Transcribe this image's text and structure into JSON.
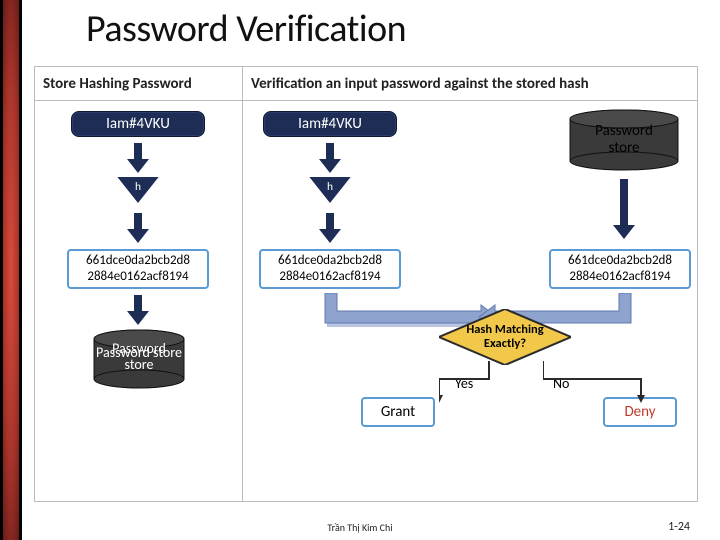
{
  "slide": {
    "title": "Password Verification",
    "columns": {
      "store_heading": "Store Hashing Password",
      "verify_heading": "Verification an input password against the stored hash"
    },
    "values": {
      "input_password": "Iam#4VKU",
      "hash_fn_label": "h",
      "hash_line1": "661dce0da2bcb2d8",
      "hash_line2": "2884e0162acf8194",
      "password_store_label": "Password store"
    },
    "decision": {
      "label_line1": "Hash Matching",
      "label_line2": "Exactly?",
      "yes": "Yes",
      "no": "No",
      "grant": "Grant",
      "deny": "Deny"
    },
    "footer": {
      "author": "Trần Thị Kim Chi",
      "page": "1-24"
    },
    "colors": {
      "accent_border": "#5a9bd5",
      "navy": "#1e2d56",
      "diamond": "#f2c84b",
      "deny": "#c0392b"
    }
  }
}
